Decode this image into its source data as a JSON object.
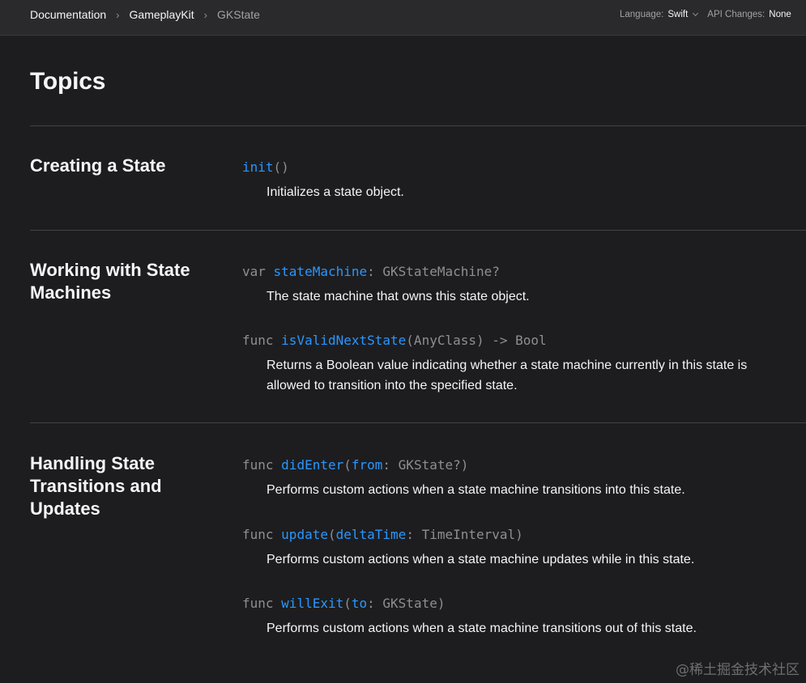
{
  "breadcrumb": {
    "items": [
      "Documentation",
      "GameplayKit",
      "GKState"
    ]
  },
  "nav": {
    "language_label": "Language:",
    "language_value": "Swift",
    "api_label": "API Changes:",
    "api_value": "None"
  },
  "topics": {
    "title": "Topics",
    "sections": [
      {
        "title": "Creating a State",
        "items": [
          {
            "decl": [
              "",
              "init",
              "()"
            ],
            "description": "Initializes a state object."
          }
        ]
      },
      {
        "title": "Working with State Machines",
        "items": [
          {
            "decl": [
              "var ",
              "stateMachine",
              ": GKStateMachine?"
            ],
            "description": "The state machine that owns this state object."
          },
          {
            "decl": [
              "func ",
              "isValidNextState",
              "(AnyClass) -> Bool"
            ],
            "description": "Returns a Boolean value indicating whether a state machine currently in this state is allowed to transition into the specified state."
          }
        ]
      },
      {
        "title": "Handling State Transitions and Updates",
        "items": [
          {
            "decl": [
              "func ",
              "didEnter",
              "(",
              "from",
              ": GKState?)"
            ],
            "description": "Performs custom actions when a state machine transitions into this state."
          },
          {
            "decl": [
              "func ",
              "update",
              "(",
              "deltaTime",
              ": TimeInterval)"
            ],
            "description": "Performs custom actions when a state machine updates while in this state."
          },
          {
            "decl": [
              "func ",
              "willExit",
              "(",
              "to",
              ": GKState)"
            ],
            "description": "Performs custom actions when a state machine transitions out of this state."
          }
        ]
      }
    ]
  },
  "watermark": "@稀土掘金技术社区",
  "icons": {
    "breadcrumb_separator": "chevron-right-icon",
    "dropdown": "chevron-down-icon"
  },
  "colors": {
    "background": "#1d1d1f",
    "link": "#2997ff",
    "muted": "#8e8e93"
  }
}
